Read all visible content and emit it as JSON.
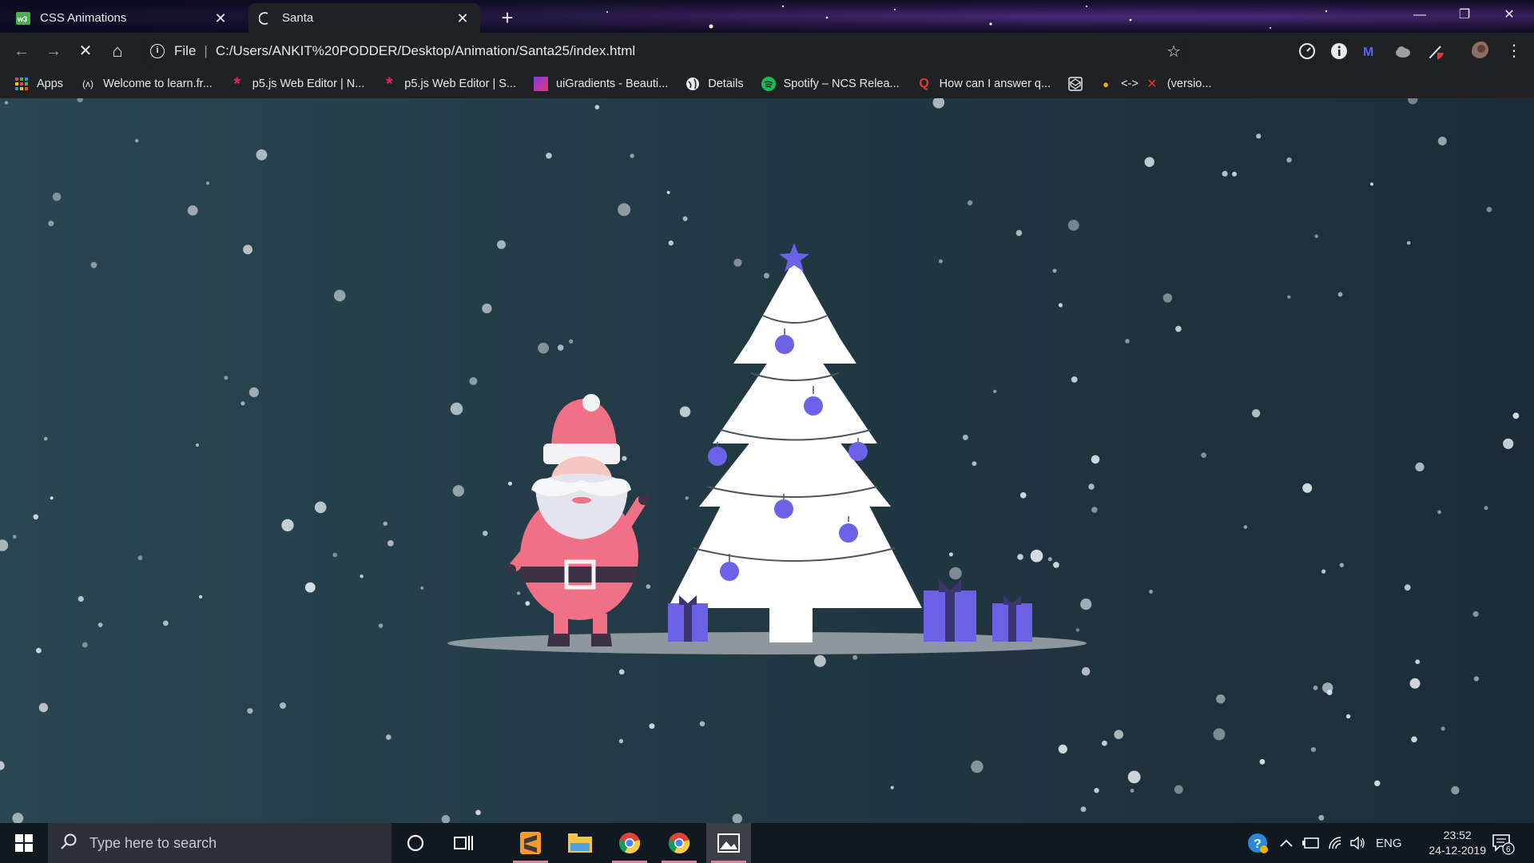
{
  "window": {
    "tabs": [
      {
        "title": "CSS Animations",
        "icon": "w3schools-icon",
        "active": false
      },
      {
        "title": "Santa",
        "icon": "loading-spinner-icon",
        "active": true
      }
    ],
    "controls": {
      "minimize": "—",
      "maximize": "❐",
      "close": "✕"
    }
  },
  "toolbar": {
    "back": "←",
    "forward": "→",
    "stop": "✕",
    "home": "⌂",
    "scheme": "File",
    "url": "C:/Users/ANKIT%20PODDER/Desktop/Animation/Santa25/index.html",
    "extensions": [
      "gauge-extension-icon",
      "info-extension-icon",
      "m-extension-icon",
      "cloud-extension-icon",
      "pen-extension-icon",
      "profile-avatar"
    ]
  },
  "bookmarks": [
    {
      "label": "Apps",
      "icon": "apps-grid-icon"
    },
    {
      "label": "Welcome to learn.fr...",
      "icon": "freecodecamp-icon"
    },
    {
      "label": "p5.js Web Editor | N...",
      "icon": "p5js-asterisk-icon"
    },
    {
      "label": "p5.js Web Editor | S...",
      "icon": "p5js-asterisk-icon"
    },
    {
      "label": "uiGradients - Beauti...",
      "icon": "uigradients-icon"
    },
    {
      "label": "Details",
      "icon": "globe-icon"
    },
    {
      "label": "Spotify – NCS Relea...",
      "icon": "spotify-icon"
    },
    {
      "label": "How can I answer q...",
      "icon": "quora-icon"
    },
    {
      "label": "",
      "icon": "codepen-icon"
    },
    {
      "label": "<->",
      "icon": "hamburger-icon"
    },
    {
      "label": "(versio...",
      "icon": "red-x-icon"
    }
  ],
  "scene": {
    "background_colors": [
      "#2a4650",
      "#1b2c38"
    ],
    "ornament_color": "#6b62e8",
    "santa_color": "#f07086",
    "tree_color": "#ffffff",
    "ground_color": "#9aa2a8"
  },
  "taskbar": {
    "search_placeholder": "Type here to search",
    "apps": [
      "cortana-circle-icon",
      "task-view-icon",
      "sublime-text-icon",
      "file-explorer-icon",
      "chrome-icon",
      "chrome-icon",
      "photos-icon"
    ],
    "tray": {
      "language": "ENG",
      "time": "23:52",
      "date": "24-12-2019",
      "notifications": "6"
    }
  }
}
